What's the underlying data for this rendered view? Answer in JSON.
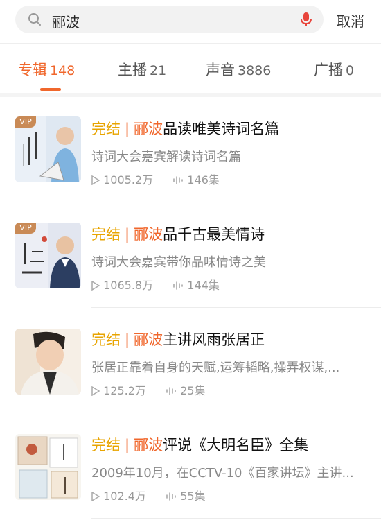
{
  "search": {
    "query": "郦波",
    "cancel_label": "取消"
  },
  "tabs": [
    {
      "label": "专辑",
      "count": "148",
      "active": true
    },
    {
      "label": "主播",
      "count": "21"
    },
    {
      "label": "声音",
      "count": "3886"
    },
    {
      "label": "广播",
      "count": "0"
    }
  ],
  "albums": [
    {
      "status": "完结",
      "highlight": "郦波",
      "title_rest": "品读唯美诗词名篇",
      "desc": "诗词大会嘉宾解读诗词名篇",
      "plays": "1005.2万",
      "episodes": "146集",
      "vip": "VIP"
    },
    {
      "status": "完结",
      "highlight": "郦波",
      "title_rest": "品千古最美情诗",
      "desc": "诗词大会嘉宾带你品味情诗之美",
      "plays": "1065.8万",
      "episodes": "144集",
      "vip": "VIP"
    },
    {
      "status": "完结",
      "highlight": "郦波",
      "title_rest": "主讲风雨张居正",
      "desc": "张居正靠着自身的天赋,运筹韬略,操弄权谋,...",
      "plays": "125.2万",
      "episodes": "25集"
    },
    {
      "status": "完结",
      "highlight": "郦波",
      "title_rest": "评说《大明名臣》全集",
      "desc": "2009年10月，在CCTV-10《百家讲坛》主讲...",
      "plays": "102.4万",
      "episodes": "55集"
    }
  ],
  "colors": {
    "accent": "#f0672c",
    "status": "#e8a400"
  }
}
